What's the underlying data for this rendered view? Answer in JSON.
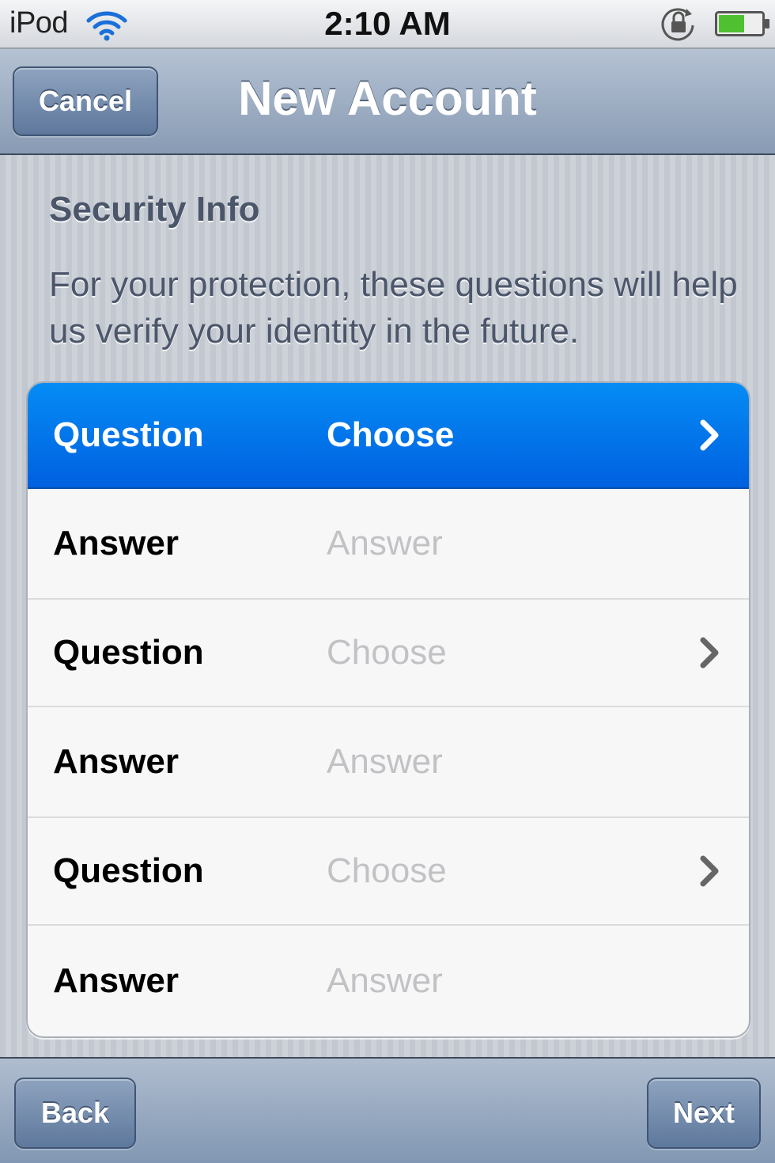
{
  "status_bar": {
    "carrier": "iPod",
    "time": "2:10 AM"
  },
  "nav": {
    "title": "New Account",
    "cancel_label": "Cancel"
  },
  "section": {
    "title": "Security Info",
    "description": "For your protection, these questions will help us verify your identity in the future."
  },
  "rows": [
    {
      "label": "Question",
      "value": "Choose",
      "selected": true,
      "chevron": true
    },
    {
      "label": "Answer",
      "value": "Answer",
      "selected": false,
      "chevron": false
    },
    {
      "label": "Question",
      "value": "Choose",
      "selected": false,
      "chevron": true
    },
    {
      "label": "Answer",
      "value": "Answer",
      "selected": false,
      "chevron": false
    },
    {
      "label": "Question",
      "value": "Choose",
      "selected": false,
      "chevron": true
    },
    {
      "label": "Answer",
      "value": "Answer",
      "selected": false,
      "chevron": false
    }
  ],
  "toolbar": {
    "back_label": "Back",
    "next_label": "Next"
  },
  "colors": {
    "selected_row": "#0070e8",
    "nav_bar": "#9fb0c6",
    "placeholder": "#c2c2c6"
  }
}
